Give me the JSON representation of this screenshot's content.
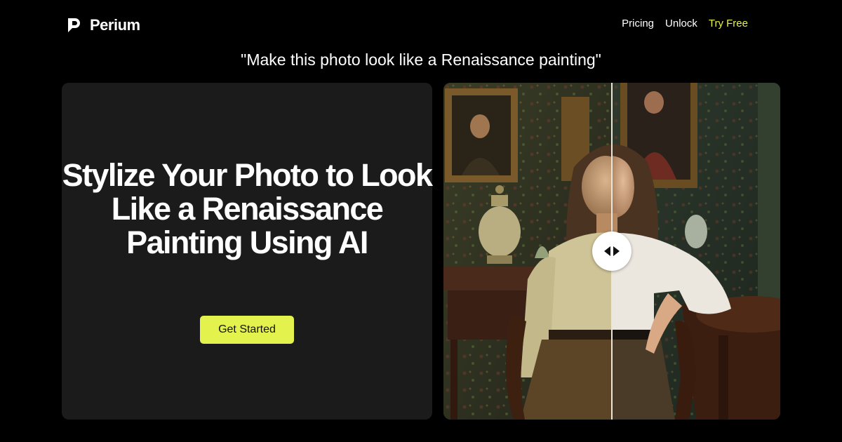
{
  "brand": {
    "name": "Perium",
    "logo_icon": "perium-logo-icon"
  },
  "nav": {
    "links": [
      {
        "label": "Pricing"
      },
      {
        "label": "Unlock"
      },
      {
        "label": "Try Free"
      }
    ]
  },
  "prompt": "\"Make this photo look like a Renaissance painting\"",
  "hero": {
    "headline": "Stylize Your Photo to Look Like a Renaissance Painting Using AI",
    "cta_label": "Get Started"
  },
  "comparison": {
    "left_label": "renaissance-painting-version",
    "right_label": "original-photo",
    "slider_position": 0.5,
    "handle_icon": "left-right-arrows-icon"
  },
  "colors": {
    "background": "#000000",
    "card": "#1b1b1b",
    "accent": "#e3f24c",
    "accent_link": "#e6f24a",
    "text": "#ffffff"
  }
}
